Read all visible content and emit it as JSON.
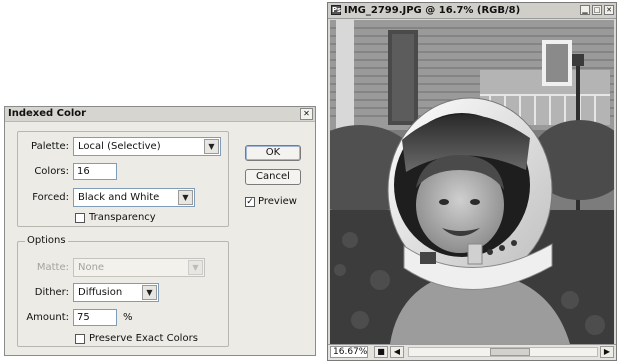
{
  "dialog": {
    "title": "Indexed Color",
    "palette_label": "Palette:",
    "palette_value": "Local (Selective)",
    "colors_label": "Colors:",
    "colors_value": "16",
    "forced_label": "Forced:",
    "forced_value": "Black and White",
    "transparency_label": "Transparency",
    "transparency_checked": false,
    "options_label": "Options",
    "matte_label": "Matte:",
    "matte_value": "None",
    "dither_label": "Dither:",
    "dither_value": "Diffusion",
    "amount_label": "Amount:",
    "amount_value": "75",
    "amount_unit": "%",
    "preserve_label": "Preserve Exact Colors",
    "preserve_checked": false,
    "ok_label": "OK",
    "cancel_label": "Cancel",
    "preview_label": "Preview",
    "preview_checked": true
  },
  "image_window": {
    "title": "IMG_2799.JPG @ 16.7% (RGB/8)",
    "zoom": "16.67%",
    "scroll_position": 0.55,
    "icons": [
      "document-icon",
      "minimize-icon",
      "maximize-icon",
      "close-icon",
      "navigator-icon",
      "scroll-left-icon",
      "scroll-right-icon"
    ]
  }
}
